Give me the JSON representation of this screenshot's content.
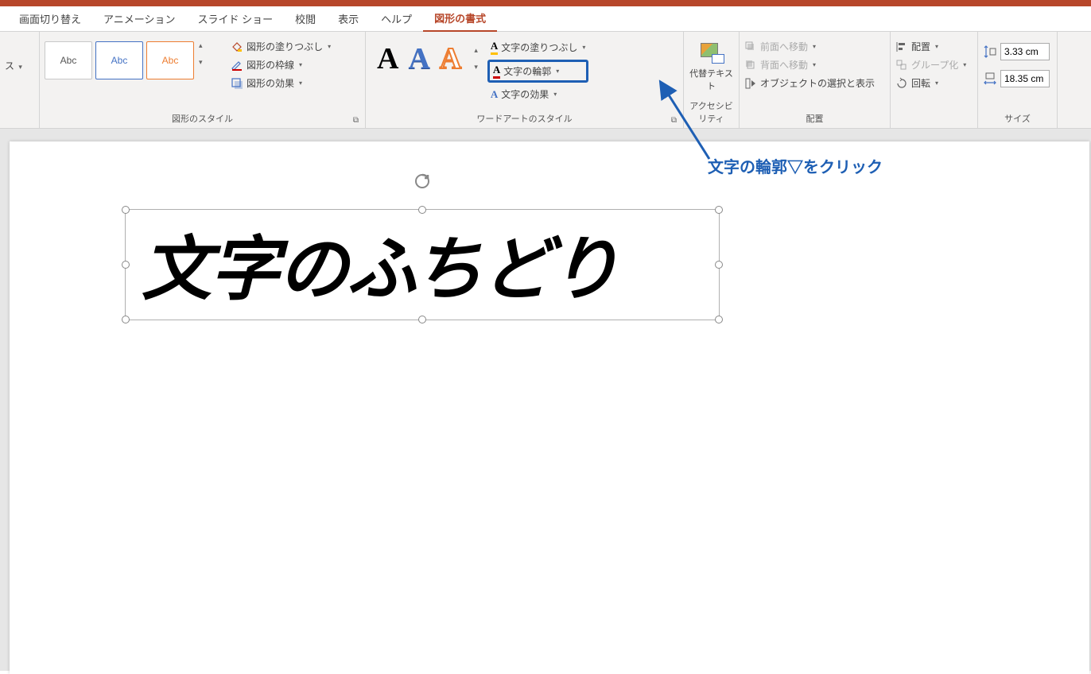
{
  "tabs": {
    "transition": "画面切り替え",
    "animation": "アニメーション",
    "slideshow": "スライド ショー",
    "review": "校閲",
    "view": "表示",
    "help": "ヘルプ",
    "shape_format": "図形の書式"
  },
  "ribbon": {
    "truncated_left": "ス",
    "shape_styles": {
      "preview_label": "Abc",
      "fill": "図形の塗りつぶし",
      "outline": "図形の枠線",
      "effects": "図形の効果",
      "group_label": "図形のスタイル"
    },
    "wordart": {
      "text_fill": "文字の塗りつぶし",
      "text_outline": "文字の輪郭",
      "text_effects": "文字の効果",
      "group_label": "ワードアートのスタイル"
    },
    "accessibility": {
      "alt_text": "代替テキスト",
      "group_label": "アクセシビリティ"
    },
    "arrange": {
      "bring_forward": "前面へ移動",
      "send_backward": "背面へ移動",
      "selection_pane": "オブジェクトの選択と表示",
      "align": "配置",
      "group": "グループ化",
      "rotate": "回転",
      "group_label": "配置"
    },
    "size": {
      "height": "3.33 cm",
      "width": "18.35 cm",
      "group_label": "サイズ"
    }
  },
  "slide": {
    "textbox_content": "文字のふちどり"
  },
  "annotation": {
    "text": "文字の輪郭▽をクリック"
  }
}
